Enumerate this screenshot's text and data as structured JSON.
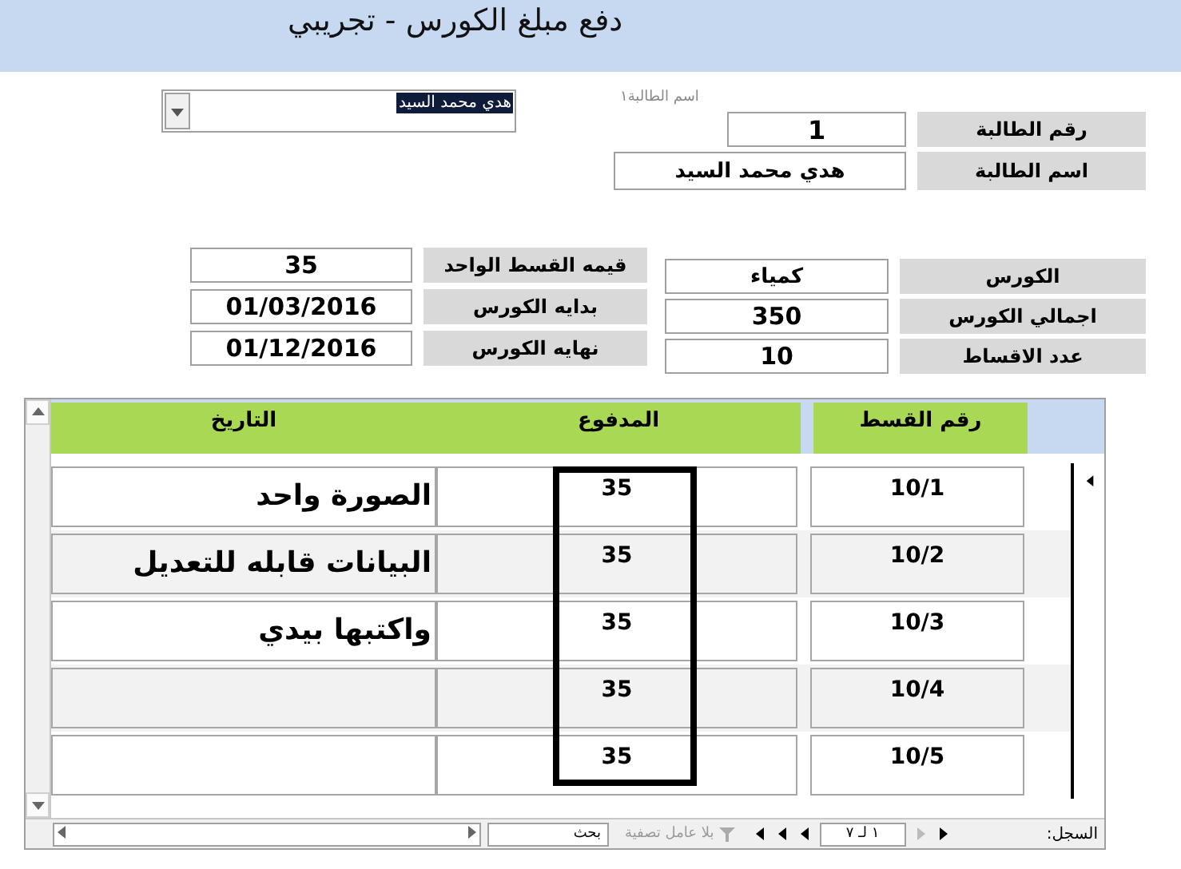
{
  "title": "دفع مبلغ الكورس - تجريبي",
  "student_picker": {
    "label": "اسم الطالبة١",
    "value": "هدي محمد السيد"
  },
  "student_fields": [
    {
      "label": "رقم الطالبة",
      "value": "1"
    },
    {
      "label": "اسم الطالبة",
      "value": "هدي محمد السيد"
    }
  ],
  "course_fields": [
    {
      "label": "الكورس",
      "value": "كمياء"
    },
    {
      "label": "اجمالي الكورس",
      "value": "350"
    },
    {
      "label": "عدد الاقساط",
      "value": "10"
    }
  ],
  "installment_fields": [
    {
      "label": "قيمه القسط الواحد",
      "value": "35"
    },
    {
      "label": "بدايه الكورس",
      "value": "01/03/2016"
    },
    {
      "label": "نهايه الكورس",
      "value": "01/12/2016"
    }
  ],
  "subform": {
    "columns": [
      "رقم القسط",
      "المدفوع",
      "التاريخ"
    ],
    "rows": [
      {
        "number": "10/1",
        "paid": "35",
        "current": true
      },
      {
        "number": "10/2",
        "paid": "35",
        "current": false
      },
      {
        "number": "10/3",
        "paid": "35",
        "current": false
      },
      {
        "number": "10/4",
        "paid": "35",
        "current": false
      },
      {
        "number": "10/5",
        "paid": "35",
        "current": false
      }
    ],
    "annotation": [
      "الصورة واحد",
      "البيانات قابله للتعديل",
      "واكتبها بيدي"
    ]
  },
  "nav": {
    "label": "السجل:",
    "record": "١ لـ ٧",
    "filter": "بلا عامل تصفية",
    "search": "بحث"
  }
}
